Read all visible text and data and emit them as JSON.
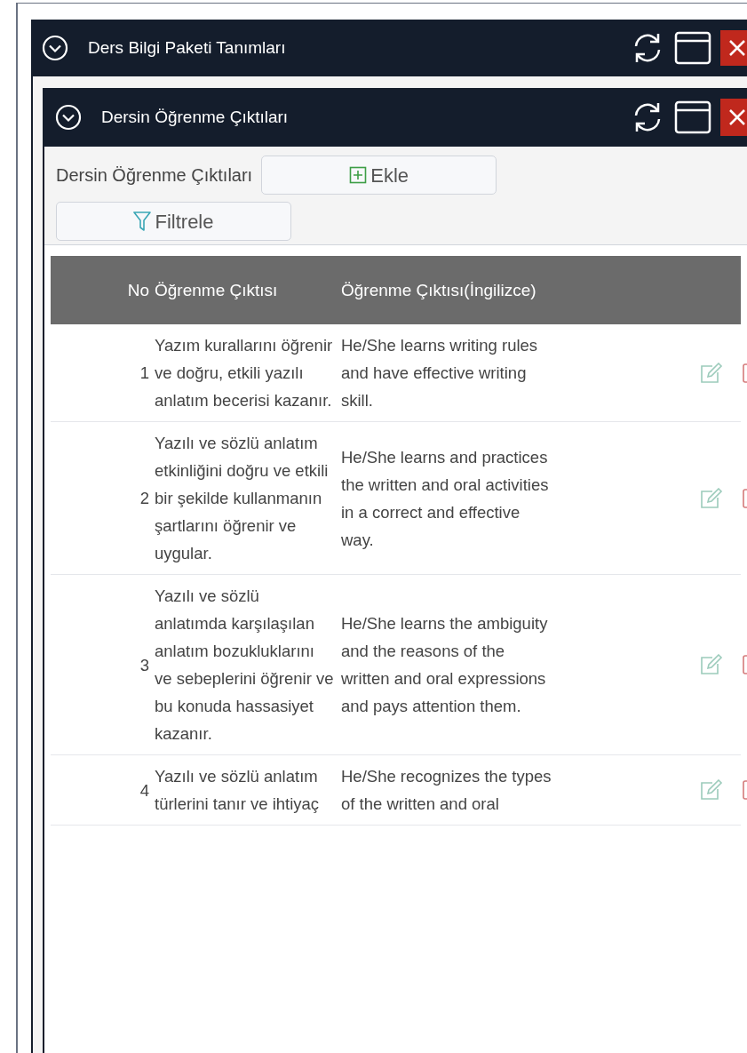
{
  "outer_window": {
    "title": "Ders Bilgi Paketi Tanımları"
  },
  "inner_window": {
    "title": "Dersin Öğrenme Çıktıları"
  },
  "toolbar": {
    "label": "Dersin Öğrenme Çıktıları",
    "buttons": [
      {
        "kind": "add",
        "label": "Ekle"
      },
      {
        "kind": "filter",
        "label": "Filtrele"
      }
    ]
  },
  "table": {
    "columns": [
      "No",
      "Öğrenme Çıktısı",
      "Öğrenme Çıktısı(İngilizce)"
    ],
    "rows": [
      {
        "no": "1",
        "outcome": "Yazım kurallarını öğrenir ve doğru, etkili yazılı anlatım becerisi kazanır.",
        "outcome_en": "He/She learns writing rules and have effective writing skill."
      },
      {
        "no": "2",
        "outcome": "Yazılı ve sözlü anlatım etkinliğini doğru ve etkili bir şekilde kullanmanın şartlarını öğrenir ve uygular.",
        "outcome_en": "He/She learns and practices the written and oral activities in a correct and effective way."
      },
      {
        "no": "3",
        "outcome": "Yazılı ve sözlü anlatımda karşılaşılan anlatım bozukluklarını ve sebeplerini öğrenir ve bu konuda hassasiyet kazanır.",
        "outcome_en": "He/She learns the ambiguity and the reasons of the written and oral expressions and pays attention them."
      },
      {
        "no": "4",
        "outcome": "Yazılı ve sözlü anlatım türlerini tanır ve ihtiyaç",
        "outcome_en": "He/She recognizes the types of the written and oral"
      }
    ]
  }
}
